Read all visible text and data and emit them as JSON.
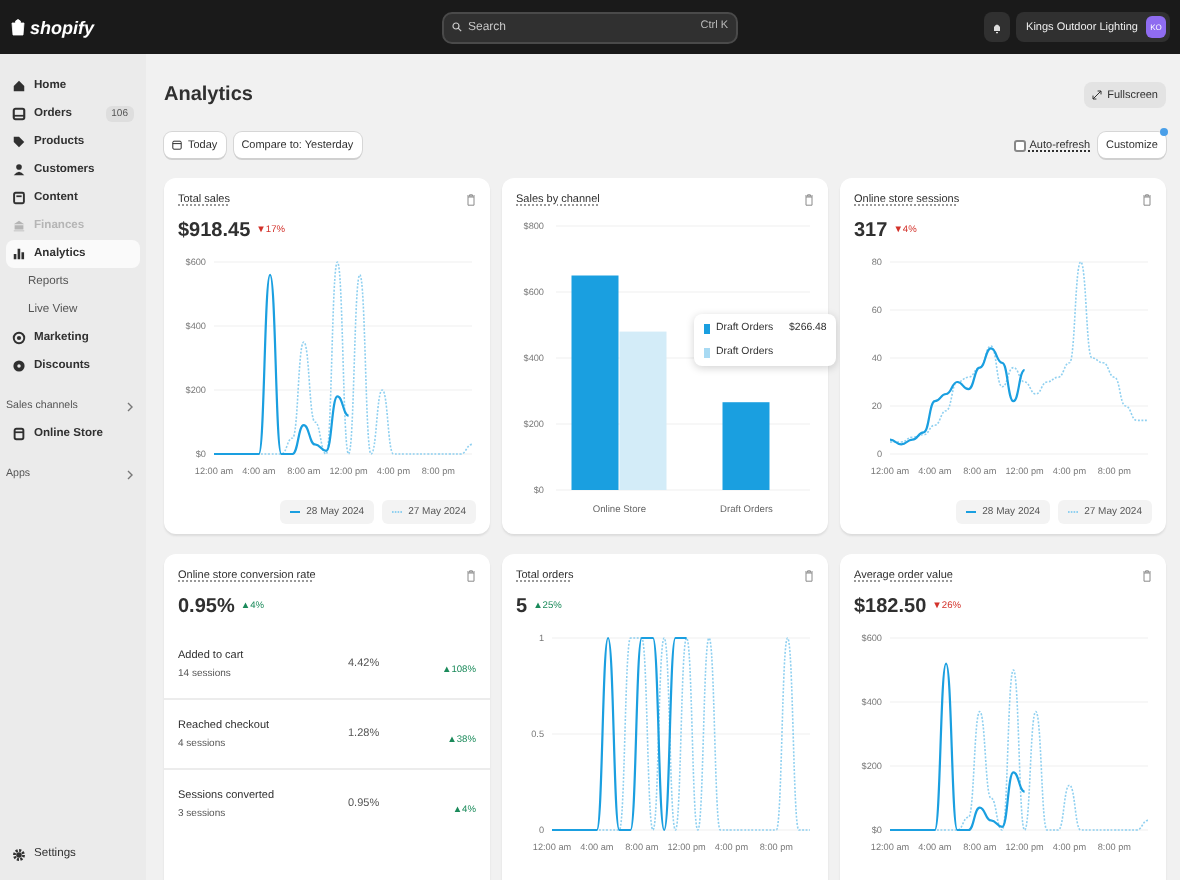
{
  "topbar": {
    "logo": "shopify",
    "search": {
      "placeholder": "Search",
      "shortcut": "Ctrl K"
    },
    "store": {
      "name": "Kings Outdoor Lighting",
      "initials": "KO"
    }
  },
  "sidebar": {
    "items": [
      {
        "kind": "item",
        "label": "Home",
        "selected": false,
        "disabled": false
      },
      {
        "kind": "item",
        "label": "Orders",
        "badge": "106",
        "selected": false,
        "disabled": false
      },
      {
        "kind": "item",
        "label": "Products",
        "selected": false,
        "disabled": false
      },
      {
        "kind": "item",
        "label": "Customers",
        "selected": false,
        "disabled": false
      },
      {
        "kind": "item",
        "label": "Content",
        "selected": false,
        "disabled": false
      },
      {
        "kind": "item",
        "label": "Finances",
        "selected": false,
        "disabled": true
      },
      {
        "kind": "item",
        "label": "Analytics",
        "selected": true,
        "disabled": false
      },
      {
        "kind": "sub",
        "label": "Reports",
        "selected": false
      },
      {
        "kind": "sub",
        "label": "Live View",
        "selected": false
      },
      {
        "kind": "item",
        "label": "Marketing",
        "selected": false,
        "disabled": false
      },
      {
        "kind": "item",
        "label": "Discounts",
        "selected": false,
        "disabled": false
      },
      {
        "kind": "section",
        "label": "Sales channels"
      },
      {
        "kind": "item",
        "label": "Online Store",
        "selected": false,
        "disabled": false
      },
      {
        "kind": "section",
        "label": "Apps"
      }
    ],
    "footer": {
      "label": "Settings"
    }
  },
  "page": {
    "title": "Analytics",
    "fullscreen_button": "Fullscreen"
  },
  "toolbar": {
    "date_button": "Today",
    "compare_button": "Compare to: Yesterday",
    "auto_refresh": {
      "label": "Auto-refresh",
      "checked": false
    },
    "customize_button": {
      "label": "Customize",
      "notification": true
    }
  },
  "cards": [
    {
      "kind": "line",
      "title": "Total sales",
      "value": "$918.45",
      "change": {
        "text": "▼17%",
        "color": "#d3312a"
      },
      "chart_data": {
        "type": "line",
        "grid": true,
        "x": [
          0,
          1,
          2,
          3,
          4,
          5,
          6,
          7,
          8,
          9,
          10,
          11,
          12,
          13,
          14,
          15,
          16,
          17,
          18,
          19,
          20,
          21,
          22,
          23
        ],
        "xlim": [
          0,
          23
        ],
        "ylim": [
          0,
          600
        ],
        "xticks": [
          {
            "value": 0,
            "label": "12:00 am"
          },
          {
            "value": 4,
            "label": "4:00 am"
          },
          {
            "value": 8,
            "label": "8:00 am"
          },
          {
            "value": 12,
            "label": "12:00 pm"
          },
          {
            "value": 16,
            "label": "4:00 pm"
          },
          {
            "value": 20,
            "label": "8:00 pm"
          }
        ],
        "yticks": [
          {
            "value": 0,
            "label": "$0"
          },
          {
            "value": 200,
            "label": "$200"
          },
          {
            "value": 400,
            "label": "$400"
          },
          {
            "value": 600,
            "label": "$600"
          }
        ],
        "series": [
          {
            "name": "28 May 2024",
            "color": "#1a9fe0",
            "line_style": "solid",
            "values": [
              0,
              0,
              0,
              0,
              0,
              560,
              0,
              0,
              90,
              30,
              10,
              180,
              120,
              null,
              null,
              null,
              null,
              null,
              null,
              null,
              null,
              null,
              null,
              null
            ]
          },
          {
            "name": "27 May 2024",
            "color": "#8fd0f0",
            "line_style": "dotted",
            "values": [
              0,
              0,
              0,
              0,
              0,
              0,
              0,
              50,
              350,
              100,
              0,
              600,
              0,
              560,
              0,
              200,
              0,
              0,
              0,
              0,
              0,
              0,
              0,
              30
            ]
          }
        ]
      }
    },
    {
      "kind": "bar",
      "title": "Sales by channel",
      "tooltip": [
        {
          "label": "Draft Orders",
          "value": "$266.48",
          "color": "#1a9fe0"
        },
        {
          "label": "Draft Orders",
          "color": "#a8daf3"
        }
      ],
      "chart_data": {
        "type": "bar",
        "grid": true,
        "categories": [
          "Online Store",
          "Draft Orders"
        ],
        "ylim": [
          0,
          800
        ],
        "yticks": [
          {
            "value": 0,
            "label": "$0"
          },
          {
            "value": 200,
            "label": "$200"
          },
          {
            "value": 400,
            "label": "$400"
          },
          {
            "value": 600,
            "label": "$600"
          },
          {
            "value": 800,
            "label": "$800"
          }
        ],
        "series": [
          {
            "color": "#1a9fe0",
            "values": [
              650,
              266
            ]
          },
          {
            "color": "#d3ecf8",
            "values": [
              480,
              null
            ]
          }
        ]
      }
    },
    {
      "kind": "line",
      "title": "Online store sessions",
      "value": "317",
      "change": {
        "text": "▼4%",
        "color": "#d3312a"
      },
      "chart_data": {
        "type": "line",
        "grid": true,
        "x": [
          0,
          1,
          2,
          3,
          4,
          5,
          6,
          7,
          8,
          9,
          10,
          11,
          12,
          13,
          14,
          15,
          16,
          17,
          18,
          19,
          20,
          21,
          22,
          23
        ],
        "xlim": [
          0,
          23
        ],
        "ylim": [
          0,
          80
        ],
        "xticks": [
          {
            "value": 0,
            "label": "12:00 am"
          },
          {
            "value": 4,
            "label": "4:00 am"
          },
          {
            "value": 8,
            "label": "8:00 am"
          },
          {
            "value": 12,
            "label": "12:00 pm"
          },
          {
            "value": 16,
            "label": "4:00 pm"
          },
          {
            "value": 20,
            "label": "8:00 pm"
          }
        ],
        "yticks": [
          0,
          20,
          40,
          60,
          80
        ],
        "series": [
          {
            "name": "28 May 2024",
            "color": "#1a9fe0",
            "line_style": "solid",
            "values": [
              6,
              4,
              6,
              9,
              22,
              25,
              30,
              27,
              36,
              44,
              38,
              22,
              35,
              null,
              null,
              null,
              null,
              null,
              null,
              null,
              null,
              null,
              null,
              null
            ]
          },
          {
            "name": "27 May 2024",
            "color": "#8fd0f0",
            "line_style": "dotted",
            "values": [
              5,
              5,
              7,
              8,
              12,
              18,
              30,
              32,
              36,
              45,
              28,
              36,
              30,
              25,
              30,
              32,
              38,
              80,
              40,
              38,
              32,
              20,
              14,
              14
            ]
          }
        ]
      }
    },
    {
      "kind": "funnel",
      "title": "Online store conversion rate",
      "value": "0.95%",
      "change": {
        "text": "▲4%",
        "color": "#1a8a5a"
      },
      "rows": [
        {
          "label": "Added to cart",
          "sessions": "14 sessions",
          "rate": "4.42%",
          "change": {
            "text": "▲108%",
            "color": "#1a8a5a"
          }
        },
        {
          "label": "Reached checkout",
          "sessions": "4 sessions",
          "rate": "1.28%",
          "change": {
            "text": "▲38%",
            "color": "#1a8a5a"
          }
        },
        {
          "label": "Sessions converted",
          "sessions": "3 sessions",
          "rate": "0.95%",
          "change": {
            "text": "▲4%",
            "color": "#1a8a5a"
          }
        }
      ]
    },
    {
      "kind": "line",
      "title": "Total orders",
      "value": "5",
      "change": {
        "text": "▲25%",
        "color": "#1a8a5a"
      },
      "chart_data": {
        "type": "line",
        "grid": true,
        "x": [
          0,
          1,
          2,
          3,
          4,
          5,
          6,
          7,
          8,
          9,
          10,
          11,
          12,
          13,
          14,
          15,
          16,
          17,
          18,
          19,
          20,
          21,
          22,
          23
        ],
        "xlim": [
          0,
          23
        ],
        "ylim": [
          0,
          1
        ],
        "xticks": [
          {
            "value": 0,
            "label": "12:00 am"
          },
          {
            "value": 4,
            "label": "4:00 am"
          },
          {
            "value": 8,
            "label": "8:00 am"
          },
          {
            "value": 12,
            "label": "12:00 pm"
          },
          {
            "value": 16,
            "label": "4:00 pm"
          },
          {
            "value": 20,
            "label": "8:00 pm"
          }
        ],
        "yticks": [
          0,
          0.5,
          1
        ],
        "series": [
          {
            "color": "#1a9fe0",
            "line_style": "solid",
            "values": [
              0,
              0,
              0,
              0,
              0,
              1,
              0,
              0,
              1,
              1,
              0,
              1,
              1,
              null,
              null,
              null,
              null,
              null,
              null,
              null,
              null,
              null,
              null,
              null
            ]
          },
          {
            "color": "#8fd0f0",
            "line_style": "dotted",
            "values": [
              0,
              0,
              0,
              0,
              0,
              0,
              0,
              1,
              1,
              0,
              1,
              0,
              1,
              0,
              1,
              0,
              0,
              0,
              0,
              0,
              0,
              1,
              0,
              0
            ]
          }
        ]
      }
    },
    {
      "kind": "line",
      "title": "Average order value",
      "value": "$182.50",
      "change": {
        "text": "▼26%",
        "color": "#d3312a"
      },
      "chart_data": {
        "type": "line",
        "grid": true,
        "x": [
          0,
          1,
          2,
          3,
          4,
          5,
          6,
          7,
          8,
          9,
          10,
          11,
          12,
          13,
          14,
          15,
          16,
          17,
          18,
          19,
          20,
          21,
          22,
          23
        ],
        "xlim": [
          0,
          23
        ],
        "ylim": [
          0,
          600
        ],
        "xticks": [
          {
            "value": 0,
            "label": "12:00 am"
          },
          {
            "value": 4,
            "label": "4:00 am"
          },
          {
            "value": 8,
            "label": "8:00 am"
          },
          {
            "value": 12,
            "label": "12:00 pm"
          },
          {
            "value": 16,
            "label": "4:00 pm"
          },
          {
            "value": 20,
            "label": "8:00 pm"
          }
        ],
        "yticks": [
          {
            "value": 0,
            "label": "$0"
          },
          {
            "value": 200,
            "label": "$200"
          },
          {
            "value": 400,
            "label": "$400"
          },
          {
            "value": 600,
            "label": "$600"
          }
        ],
        "series": [
          {
            "color": "#1a9fe0",
            "line_style": "solid",
            "values": [
              0,
              0,
              0,
              0,
              0,
              520,
              0,
              0,
              70,
              30,
              10,
              180,
              120,
              null,
              null,
              null,
              null,
              null,
              null,
              null,
              null,
              null,
              null,
              null
            ]
          },
          {
            "color": "#8fd0f0",
            "line_style": "dotted",
            "values": [
              0,
              0,
              0,
              0,
              0,
              0,
              0,
              40,
              370,
              100,
              0,
              500,
              0,
              370,
              0,
              0,
              140,
              0,
              0,
              0,
              0,
              0,
              0,
              30
            ]
          }
        ]
      }
    }
  ]
}
